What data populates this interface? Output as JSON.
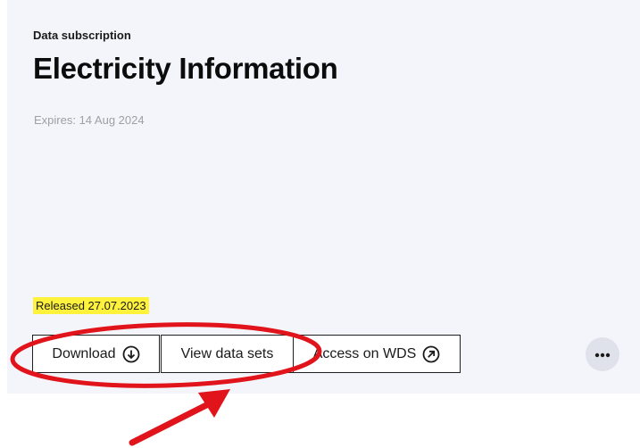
{
  "card": {
    "eyebrow": "Data subscription",
    "title": "Electricity Information",
    "expires": "Expires: 14 Aug 2024",
    "released": "Released 27.07.2023",
    "buttons": {
      "download": "Download",
      "view_data_sets": "View data sets",
      "access_wds": "Access on WDS"
    },
    "icons": {
      "download": "download-arrow-circle-icon",
      "external": "external-link-arrow-circle-icon",
      "more": "more-horizontal-icon"
    }
  },
  "annotation": {
    "color": "#e0141a",
    "shapes": [
      "ellipse-highlight",
      "pointing-arrow"
    ]
  },
  "colors": {
    "card_bg": "#f3f5fb",
    "highlight": "#fff23d",
    "more_bg": "#dfe2ea"
  }
}
